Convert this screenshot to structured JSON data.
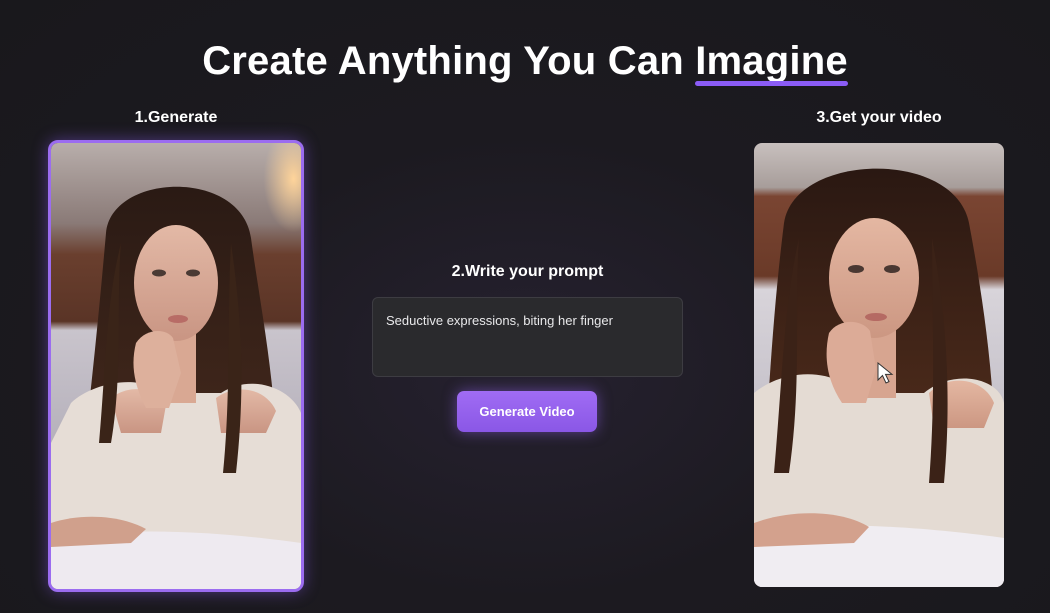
{
  "header": {
    "title_prefix": "Create Anything You Can ",
    "title_accent": "Imagine",
    "accent_color": "#8b5cf6"
  },
  "steps": {
    "step1_label": "1.Generate",
    "step2_label": "2.Write your prompt",
    "step3_label": "3.Get your video"
  },
  "prompt": {
    "value": "Seductive expressions, biting her finger"
  },
  "actions": {
    "generate_label": "Generate Video",
    "button_color": "#9a66f2"
  },
  "icons": {
    "cursor": "cursor-arrow-icon"
  }
}
